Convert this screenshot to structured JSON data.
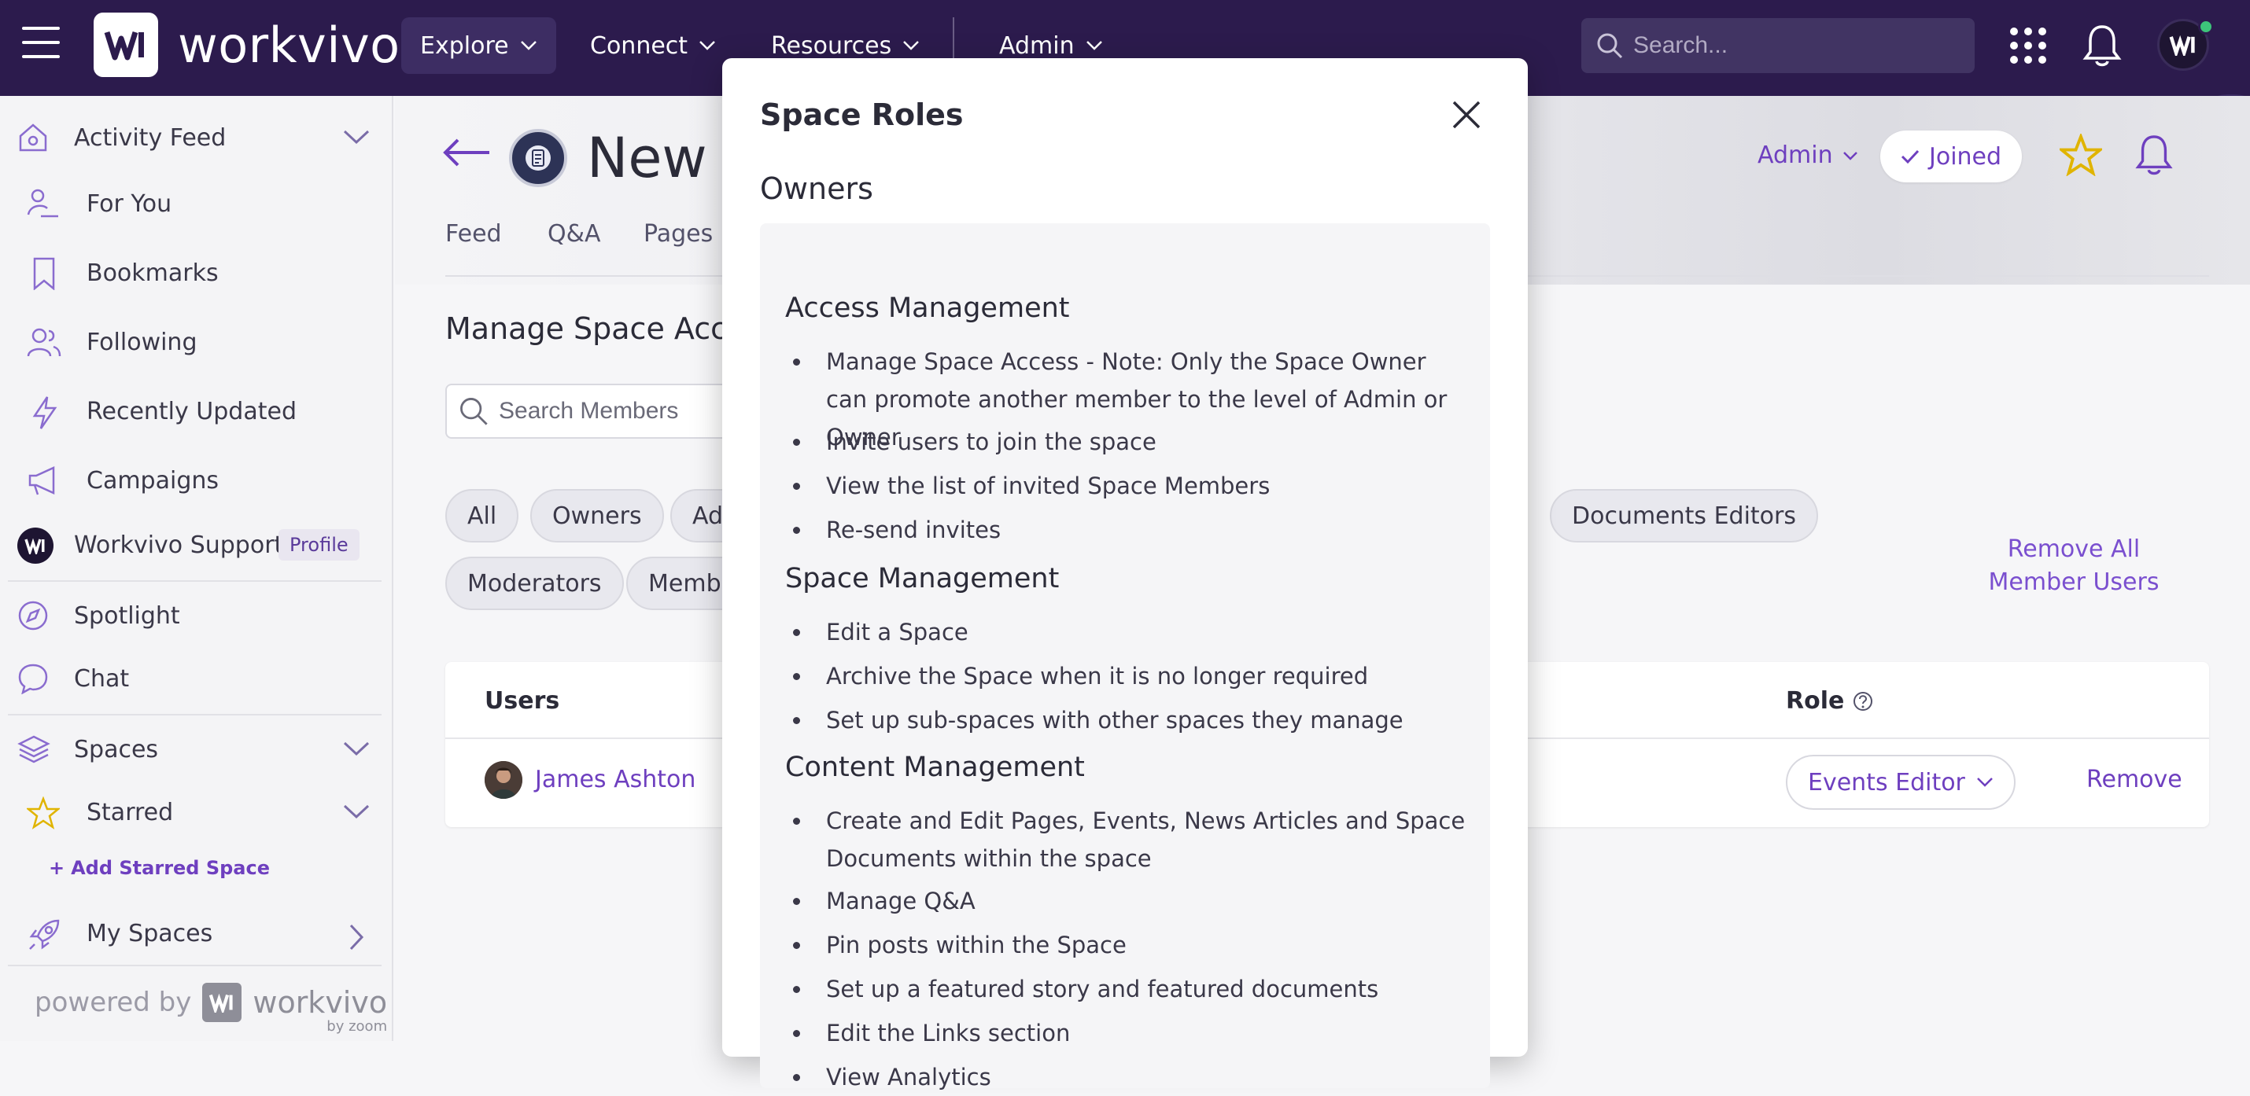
{
  "topbar": {
    "brand": "workvivo",
    "nav": [
      {
        "label": "Explore",
        "active": true
      },
      {
        "label": "Connect"
      },
      {
        "label": "Resources"
      },
      {
        "label": "Admin"
      }
    ],
    "search_placeholder": "Search...",
    "colors": {
      "bg": "#2c1b4d",
      "accent": "#6e3fbf"
    }
  },
  "sidebar": {
    "items": [
      {
        "label": "Activity Feed",
        "icon": "home-icon"
      },
      {
        "label": "For You",
        "icon": "person-sparkle-icon"
      },
      {
        "label": "Bookmarks",
        "icon": "bookmark-icon"
      },
      {
        "label": "Following",
        "icon": "people-icon"
      },
      {
        "label": "Recently Updated",
        "icon": "lightning-icon"
      },
      {
        "label": "Campaigns",
        "icon": "megaphone-icon"
      },
      {
        "label": "Workvivo Support",
        "icon": "workvivo-avatar-icon",
        "badge": "Profile"
      },
      {
        "label": "Spotlight",
        "icon": "compass-icon"
      },
      {
        "label": "Chat",
        "icon": "chat-bubble-icon"
      },
      {
        "label": "Spaces",
        "icon": "layers-icon"
      },
      {
        "label": "Starred",
        "icon": "star-icon"
      },
      {
        "label": "My Spaces",
        "icon": "rocket-icon"
      }
    ],
    "add_starred": "Add Starred Space",
    "powered_by": "powered by",
    "powered_brand": "workvivo",
    "powered_sub": "by zoom"
  },
  "space": {
    "title": "New H",
    "admin_label": "Admin",
    "joined_label": "Joined",
    "tabs": [
      "Feed",
      "Q&A",
      "Pages"
    ],
    "section_title": "Manage Space Acce",
    "member_search_placeholder": "Search Members",
    "chips_row1": [
      "All",
      "Owners",
      "Adm",
      "Documents Editors"
    ],
    "chips_row2": [
      "Moderators",
      "Member"
    ],
    "remove_all": "Remove All Member Users",
    "table": {
      "col_users": "Users",
      "col_role": "Role",
      "rows": [
        {
          "name": "James Ashton",
          "role": "Events Editor",
          "action": "Remove"
        }
      ]
    }
  },
  "modal": {
    "title": "Space Roles",
    "role": "Owners",
    "sections": [
      {
        "heading": "Access Management",
        "items": [
          "Manage Space Access - Note: Only the Space Owner can promote another member to the level of Admin or Owner",
          "Invite users to join the space",
          "View the list of invited Space Members",
          "Re-send invites"
        ]
      },
      {
        "heading": "Space Management",
        "items": [
          "Edit a Space",
          "Archive the Space when it is no longer required",
          "Set up sub-spaces with other spaces they manage"
        ]
      },
      {
        "heading": "Content Management",
        "items": [
          "Create and Edit Pages, Events, News Articles and Space Documents within the space",
          "Manage Q&A",
          "Pin posts within the Space",
          "Set up a featured story and featured documents",
          "Edit the Links section",
          "View Analytics"
        ]
      }
    ]
  }
}
